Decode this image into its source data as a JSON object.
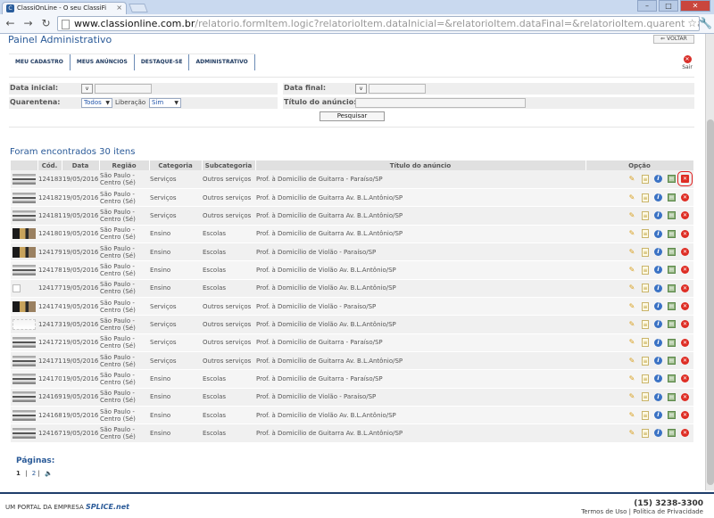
{
  "browser": {
    "tab_title": "ClassiOnLine - O seu ClassiFi",
    "url_host": "www.classionline.com.br",
    "url_path": "/relatorio.formItem.logic?relatorioItem.dataInicial=&relatorioItem.dataFinal=&relatorioItem.quarentena=&relatorioItem.liberacao="
  },
  "header": {
    "title": "Painel Administrativo",
    "voltar_label": "VOLTAR",
    "sair_label": "Sair",
    "nav": [
      "MEU CADASTRO",
      "MEUS ANÚNCIOS",
      "DESTAQUE-SE",
      "ADMINISTRATIVO"
    ]
  },
  "filters": {
    "data_inicial_label": "Data inicial:",
    "data_final_label": "Data final:",
    "v_button": "v",
    "quarentena_label": "Quarentena:",
    "quarentena_value": "Todos",
    "liberacao_label": "Liberação",
    "liberacao_value": "Sim",
    "titulo_label": "Título do anúncio:",
    "pesquisar_label": "Pesquisar"
  },
  "results": {
    "title": "Foram encontrados 30 itens",
    "columns": [
      "",
      "Cód.",
      "Data",
      "Região",
      "Categoria",
      "Subcategoria",
      "Título do anúncio",
      "Opção"
    ],
    "rows": [
      {
        "thumb": "a",
        "cod": "124183",
        "data": "19/05/2016",
        "regiao": "São Paulo - Centro (Sé)",
        "categoria": "Serviços",
        "subcategoria": "Outros serviços",
        "titulo": "Prof. à Domicílio de Guitarra - Paraíso/SP"
      },
      {
        "thumb": "a",
        "cod": "124182",
        "data": "19/05/2016",
        "regiao": "São Paulo - Centro (Sé)",
        "categoria": "Serviços",
        "subcategoria": "Outros serviços",
        "titulo": "Prof. à Domicílio de Guitarra Av. B.L.Antônio/SP"
      },
      {
        "thumb": "a",
        "cod": "124181",
        "data": "19/05/2016",
        "regiao": "São Paulo - Centro (Sé)",
        "categoria": "Serviços",
        "subcategoria": "Outros serviços",
        "titulo": "Prof. à Domicílio de Guitarra Av. B.L.Antônio/SP"
      },
      {
        "thumb": "b",
        "cod": "124180",
        "data": "19/05/2016",
        "regiao": "São Paulo - Centro (Sé)",
        "categoria": "Ensino",
        "subcategoria": "Escolas",
        "titulo": "Prof. à Domicílio de Guitarra Av. B.L.Antônio/SP"
      },
      {
        "thumb": "b",
        "cod": "124179",
        "data": "19/05/2016",
        "regiao": "São Paulo - Centro (Sé)",
        "categoria": "Ensino",
        "subcategoria": "Escolas",
        "titulo": "Prof. à Domicílio de Violão - Paraíso/SP"
      },
      {
        "thumb": "a",
        "cod": "124178",
        "data": "19/05/2016",
        "regiao": "São Paulo - Centro (Sé)",
        "categoria": "Ensino",
        "subcategoria": "Escolas",
        "titulo": "Prof. à Domicílio de Violão Av. B.L.Antônio/SP"
      },
      {
        "thumb": "c",
        "cod": "124177",
        "data": "19/05/2016",
        "regiao": "São Paulo - Centro (Sé)",
        "categoria": "Ensino",
        "subcategoria": "Escolas",
        "titulo": "Prof. à Domicílio de Violão Av. B.L.Antônio/SP"
      },
      {
        "thumb": "b",
        "cod": "124174",
        "data": "19/05/2016",
        "regiao": "São Paulo - Centro (Sé)",
        "categoria": "Serviços",
        "subcategoria": "Outros serviços",
        "titulo": "Prof. à Domicílio de Violão - Paraíso/SP"
      },
      {
        "thumb": "d",
        "cod": "124173",
        "data": "19/05/2016",
        "regiao": "São Paulo - Centro (Sé)",
        "categoria": "Serviços",
        "subcategoria": "Outros serviços",
        "titulo": "Prof. à Domicílio de Violão Av. B.L.Antônio/SP"
      },
      {
        "thumb": "a",
        "cod": "124172",
        "data": "19/05/2016",
        "regiao": "São Paulo - Centro (Sé)",
        "categoria": "Serviços",
        "subcategoria": "Outros serviços",
        "titulo": "Prof. à Domicílio de Guitarra - Paraíso/SP"
      },
      {
        "thumb": "a",
        "cod": "124171",
        "data": "19/05/2016",
        "regiao": "São Paulo - Centro (Sé)",
        "categoria": "Serviços",
        "subcategoria": "Outros serviços",
        "titulo": "Prof. à Domicílio de Guitarra Av. B.L.Antônio/SP"
      },
      {
        "thumb": "a",
        "cod": "124170",
        "data": "19/05/2016",
        "regiao": "São Paulo - Centro (Sé)",
        "categoria": "Ensino",
        "subcategoria": "Escolas",
        "titulo": "Prof. à Domicílio de Guitarra - Paraíso/SP"
      },
      {
        "thumb": "a",
        "cod": "124169",
        "data": "19/05/2016",
        "regiao": "São Paulo - Centro (Sé)",
        "categoria": "Ensino",
        "subcategoria": "Escolas",
        "titulo": "Prof. à Domicílio de Violão - Paraíso/SP"
      },
      {
        "thumb": "a",
        "cod": "124168",
        "data": "19/05/2016",
        "regiao": "São Paulo - Centro (Sé)",
        "categoria": "Ensino",
        "subcategoria": "Escolas",
        "titulo": "Prof. à Domicílio de Violão Av. B.L.Antônio/SP"
      },
      {
        "thumb": "a",
        "cod": "124167",
        "data": "19/05/2016",
        "regiao": "São Paulo - Centro (Sé)",
        "categoria": "Ensino",
        "subcategoria": "Escolas",
        "titulo": "Prof. à Domicílio de Guitarra Av. B.L.Antônio/SP"
      }
    ],
    "row_icons": [
      "pencil-icon",
      "document-icon",
      "info-icon",
      "list-icon",
      "delete-icon"
    ],
    "highlighted_icon": "delete-icon"
  },
  "pagination": {
    "label": "Páginas:",
    "current": "1",
    "pages": [
      "2"
    ],
    "separator": "|",
    "next_icon": "speaker-icon"
  },
  "footer": {
    "portal_text": "UM PORTAL DA EMPRESA",
    "brand": "SPLICE.net",
    "phone": "(15) 3238-3300",
    "terms": "Termos de Uso",
    "privacy": "Política de Privacidade",
    "links_separator": "|"
  },
  "colors": {
    "accent": "#2a5a98",
    "footer_bar": "#1f3d6b",
    "delete": "#de2d24",
    "highlight": "#e01e1e"
  }
}
